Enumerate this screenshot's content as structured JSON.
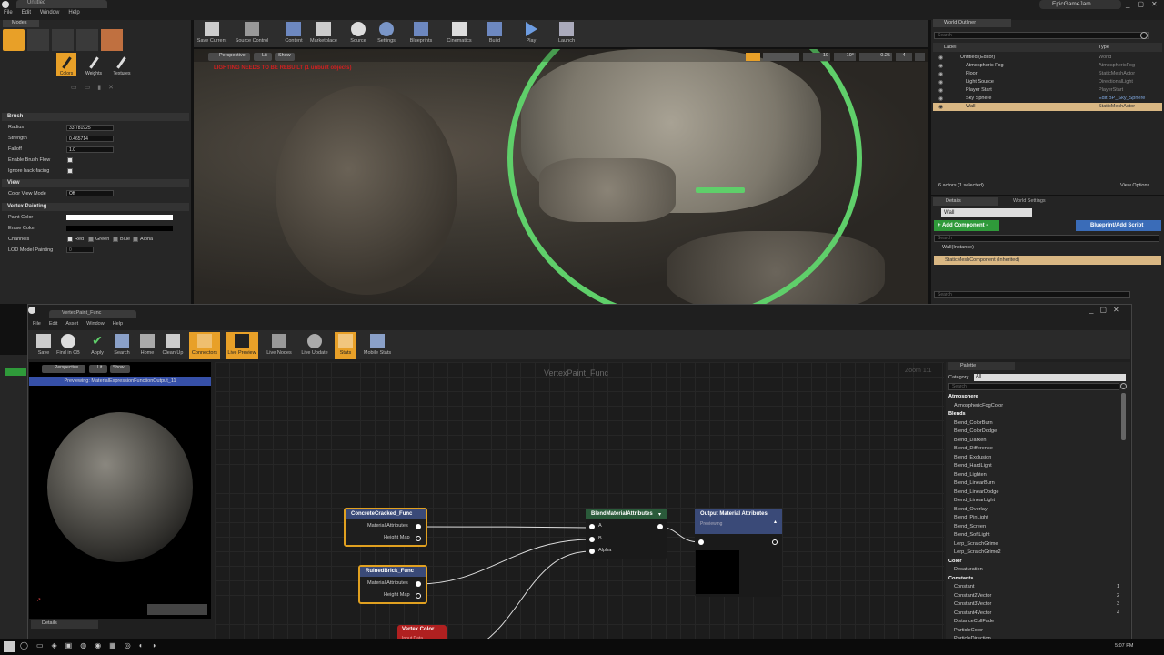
{
  "editor": {
    "tab": "Untitled",
    "menu": [
      "File",
      "Edit",
      "Window",
      "Help"
    ],
    "modes_tab": "Modes",
    "brand": "EpicGameJam",
    "toolbar": [
      "Save Current",
      "Source Control",
      "Content",
      "Marketplace",
      "Source",
      "Settings",
      "Blueprints",
      "Cinematics",
      "Build",
      "Play",
      "Launch"
    ],
    "paint_tools": [
      "Colors",
      "Weights",
      "Textures"
    ],
    "brush": {
      "header": "Brush",
      "radius_label": "Radius",
      "radius": "33.781925",
      "strength_label": "Strength",
      "strength": "0.465714",
      "falloff_label": "Falloff",
      "falloff": "1.0",
      "enable_flow": "Enable Brush Flow",
      "ignore_backfacing": "Ignore back-facing"
    },
    "view": {
      "header": "View",
      "color_view_mode_label": "Color View Mode",
      "color_view_mode": "Off"
    },
    "vertex_painting": {
      "header": "Vertex Painting",
      "paint_color": "Paint Color",
      "erase_color": "Erase Color",
      "channels": "Channels",
      "red": "Red",
      "green": "Green",
      "blue": "Blue",
      "alpha": "Alpha",
      "lod": "LOD Model Painting",
      "lod_value": "0"
    },
    "viewport": {
      "perspective": "Perspective",
      "lit": "Lit",
      "show": "Show",
      "warning": "LIGHTING NEEDS TO BE REBUILT (1 unbuilt objects)",
      "grid": "10",
      "angle": "10°",
      "scale": "0.25",
      "camera": "4"
    }
  },
  "outliner": {
    "title": "World Outliner",
    "search": "Search",
    "col_label": "Label",
    "col_type": "Type",
    "items": [
      {
        "label": "Untitled (Editor)",
        "type": "World"
      },
      {
        "label": "Atmospheric Fog",
        "type": "AtmosphericFog"
      },
      {
        "label": "Floor",
        "type": "StaticMeshActor"
      },
      {
        "label": "Light Source",
        "type": "DirectionalLight"
      },
      {
        "label": "Player Start",
        "type": "PlayerStart"
      },
      {
        "label": "Sky Sphere",
        "type": "Edit BP_Sky_Sphere"
      },
      {
        "label": "Wall",
        "type": "StaticMeshActor"
      }
    ],
    "status": "6 actors (1 selected)",
    "view_options": "View Options"
  },
  "details": {
    "tab": "Details",
    "world_settings": "World Settings",
    "name": "Wall",
    "add_component": "+ Add Component -",
    "blueprint": "Blueprint/Add Script",
    "search": "Search",
    "instance": "Wall(Instance)",
    "component": "StaticMeshComponent (Inherited)"
  },
  "material_editor": {
    "tab": "VertexPaint_Func",
    "menu": [
      "File",
      "Edit",
      "Asset",
      "Window",
      "Help"
    ],
    "toolbar": [
      "Save",
      "Find in CB",
      "Apply",
      "Search",
      "Home",
      "Clean Up",
      "Connectors",
      "Live Preview",
      "Live Nodes",
      "Live Update",
      "Stats",
      "Mobile Stats"
    ],
    "preview": {
      "perspective": "Perspective",
      "lit": "Lit",
      "show": "Show",
      "previewing": "Previewing: MaterialExpressionFunctionOutput_11"
    },
    "graph_title": "VertexPaint_Func",
    "zoom": "Zoom 1:1",
    "details_tab": "Details",
    "nodes": {
      "concrete": {
        "title": "ConcreteCracked_Func",
        "out1": "Material Attributes",
        "out2": "Height Map"
      },
      "ruined": {
        "title": "RuinedBrick_Func",
        "out1": "Material Attributes",
        "out2": "Height Map"
      },
      "vertex": {
        "title": "Vertex Color",
        "sub": "Input Data"
      },
      "blend": {
        "title": "BlendMaterialAttributes",
        "a": "A",
        "b": "B",
        "alpha": "Alpha"
      },
      "output": {
        "title": "Output Material Attributes",
        "sub": "Previewing"
      }
    },
    "palette": {
      "title": "Palette",
      "category_label": "Category",
      "category": "All",
      "search": "Search",
      "items": [
        {
          "t": "cat",
          "name": "Atmosphere"
        },
        {
          "t": "item",
          "name": "AtmosphericFogColor"
        },
        {
          "t": "cat",
          "name": "Blends"
        },
        {
          "t": "item",
          "name": "Blend_ColorBurn"
        },
        {
          "t": "item",
          "name": "Blend_ColorDodge"
        },
        {
          "t": "item",
          "name": "Blend_Darken"
        },
        {
          "t": "item",
          "name": "Blend_Difference"
        },
        {
          "t": "item",
          "name": "Blend_Exclusion"
        },
        {
          "t": "item",
          "name": "Blend_HardLight"
        },
        {
          "t": "item",
          "name": "Blend_Lighten"
        },
        {
          "t": "item",
          "name": "Blend_LinearBurn"
        },
        {
          "t": "item",
          "name": "Blend_LinearDodge"
        },
        {
          "t": "item",
          "name": "Blend_LinearLight"
        },
        {
          "t": "item",
          "name": "Blend_Overlay"
        },
        {
          "t": "item",
          "name": "Blend_PinLight"
        },
        {
          "t": "item",
          "name": "Blend_Screen"
        },
        {
          "t": "item",
          "name": "Blend_SoftLight"
        },
        {
          "t": "item",
          "name": "Lerp_ScratchGrime"
        },
        {
          "t": "item",
          "name": "Lerp_ScratchGrime2"
        },
        {
          "t": "cat",
          "name": "Color"
        },
        {
          "t": "item",
          "name": "Desaturation"
        },
        {
          "t": "cat",
          "name": "Constants"
        },
        {
          "t": "item",
          "name": "Constant",
          "key": "1"
        },
        {
          "t": "item",
          "name": "Constant2Vector",
          "key": "2"
        },
        {
          "t": "item",
          "name": "Constant3Vector",
          "key": "3"
        },
        {
          "t": "item",
          "name": "Constant4Vector",
          "key": "4"
        },
        {
          "t": "item",
          "name": "DistanceCullFade"
        },
        {
          "t": "item",
          "name": "ParticleColor"
        },
        {
          "t": "item",
          "name": "ParticleDirection"
        }
      ]
    }
  },
  "taskbar": {
    "time": "5:07 PM"
  },
  "colors": {
    "accent": "#e8a028",
    "selection": "#d9b783",
    "brush_circle": "#5fcf6a",
    "node_border": "#e0a020",
    "vertex_header": "#b02020",
    "output_header": "#3a4a78"
  }
}
